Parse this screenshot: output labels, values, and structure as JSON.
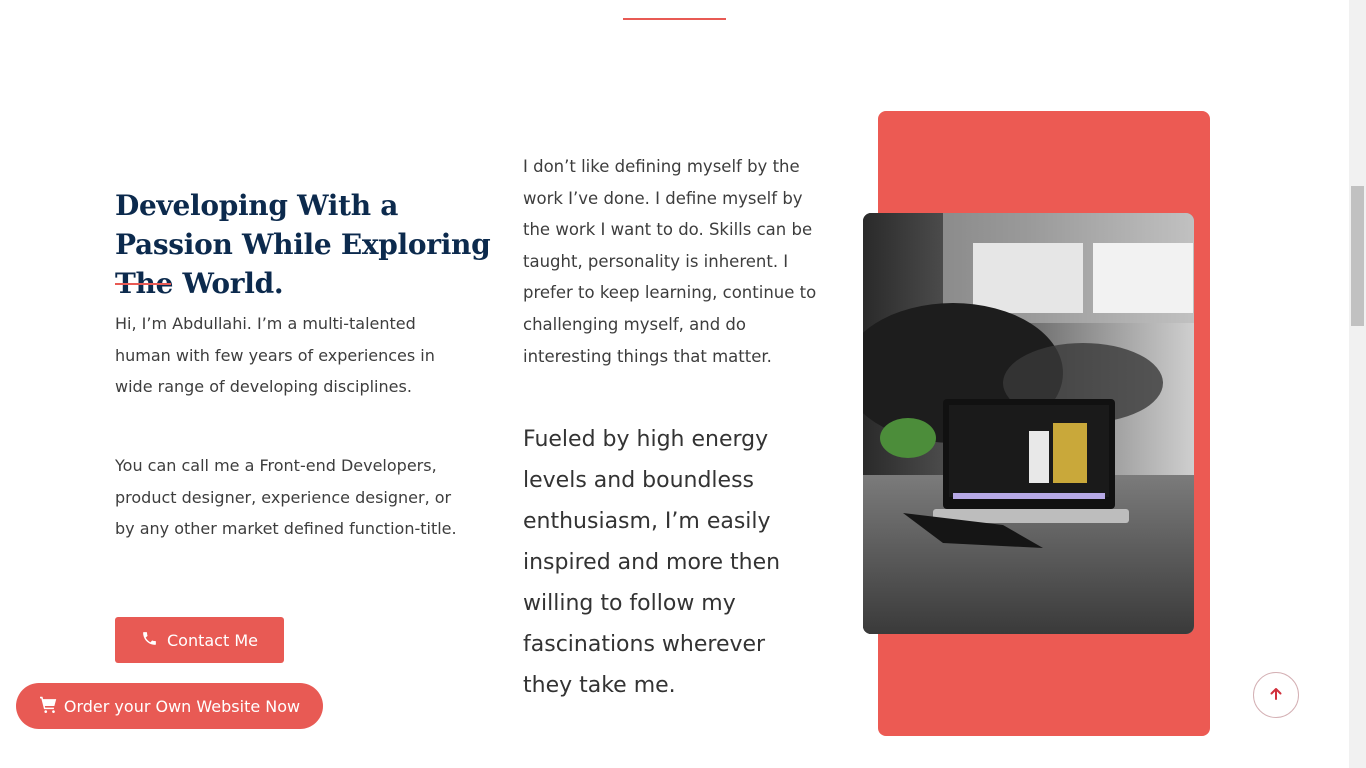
{
  "about": {
    "heading": "Developing With a Passion While Exploring The World.",
    "intro": "Hi, I’m Abdullahi. I’m a multi-talented human with few years of experiences in wide range of developing disciplines.",
    "call_me": "You can call me a Front-end Developers, product designer, experience designer, or by any other market defined function-title.",
    "quote": "I don’t like defining myself by the work I’ve done. I define myself by the work I want to do. Skills can be taught, personality is inherent. I prefer to keep learning, continue to challenging myself, and do interesting things that matter.",
    "fueled": "Fueled by high energy levels and boundless enthusiasm, I’m easily inspired and more then willing to follow my fascinations wherever they take me.",
    "contact_label": "Contact Me"
  },
  "floating": {
    "order_label": "Order your Own Website Now"
  },
  "icons": {
    "contact": "phone-icon",
    "order": "cart-icon",
    "scroll_top": "arrow-up-icon"
  },
  "colors": {
    "accent": "#e85a54",
    "heading": "#0c2a4d",
    "panel": "#ec5a53"
  }
}
